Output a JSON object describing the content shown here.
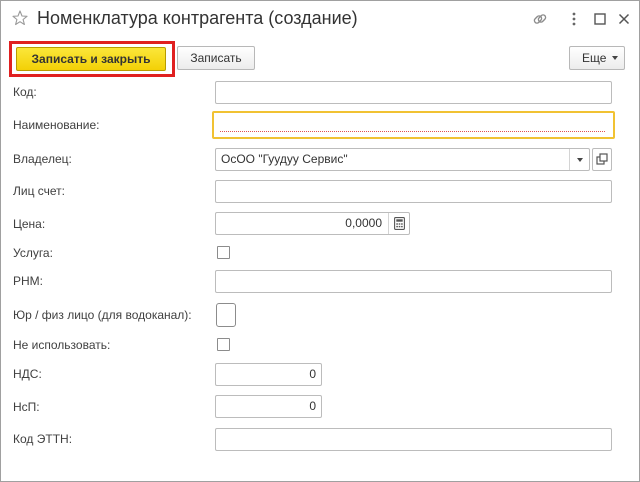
{
  "window": {
    "title": "Номенклатура контрагента (создание)"
  },
  "toolbar": {
    "save_and_close_label": "Записать и закрыть",
    "save_label": "Записать",
    "more_label": "Еще"
  },
  "form": {
    "code": {
      "label": "Код:",
      "value": ""
    },
    "name": {
      "label": "Наименование:",
      "value": ""
    },
    "owner": {
      "label": "Владелец:",
      "value": "ОсОО \"Гуудуу Сервис\""
    },
    "account": {
      "label": "Лиц счет:",
      "value": ""
    },
    "price": {
      "label": "Цена:",
      "value": "0,0000"
    },
    "service": {
      "label": "Услуга:",
      "checked": false
    },
    "rnm": {
      "label": "РНМ:",
      "value": ""
    },
    "legal_entity": {
      "label": "Юр / физ лицо (для водоканал):",
      "checked": false
    },
    "not_used": {
      "label": "Не использовать:",
      "checked": false
    },
    "vat": {
      "label": "НДС:",
      "value": "0"
    },
    "sales_tax": {
      "label": "НсП:",
      "value": "0"
    },
    "ettn_code": {
      "label": "Код ЭТТН:",
      "value": ""
    }
  },
  "colors": {
    "primary_button": "#f3d006",
    "highlight_frame": "#e02020",
    "focus_border": "#f1c232"
  },
  "icons": [
    "star-icon",
    "link-icon",
    "more-icon",
    "maximize-icon",
    "close-icon",
    "dropdown-icon",
    "open-icon",
    "calculator-icon"
  ]
}
